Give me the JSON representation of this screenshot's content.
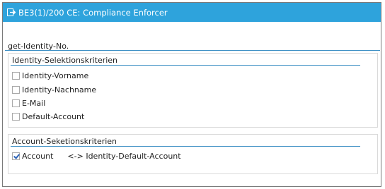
{
  "window": {
    "title": "BE3(1)/200 CE: Compliance Enforcer"
  },
  "section": {
    "title": "get-Identity-No."
  },
  "identity_criteria": {
    "title": "Identity-Selektionskriterien",
    "items": [
      {
        "label": "Identity-Vorname",
        "checked": false
      },
      {
        "label": "Identity-Nachname",
        "checked": false
      },
      {
        "label": "E-Mail",
        "checked": false
      },
      {
        "label": "Default-Account",
        "checked": false
      }
    ]
  },
  "account_criteria": {
    "title": "Account-Seketionskriterien",
    "items": [
      {
        "label": "Account",
        "checked": true,
        "note": "<-> Identity-Default-Account"
      }
    ]
  },
  "colors": {
    "titlebar": "#2ea3dc",
    "accent_rule": "#3c8fc4",
    "checkmark": "#2a62b8"
  },
  "icons": {
    "title_icon": "exit-arrow-icon"
  }
}
